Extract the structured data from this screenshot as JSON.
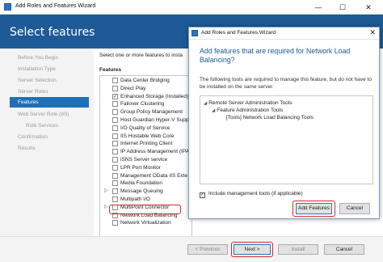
{
  "window": {
    "title": "Add Roles and Features Wizard",
    "minimize_glyph": "—",
    "maximize_glyph": "☐",
    "close_glyph": "✕"
  },
  "header": {
    "page_title": "Select features"
  },
  "nav": {
    "items": [
      {
        "label": "Before You Begin"
      },
      {
        "label": "Installation Type"
      },
      {
        "label": "Server Selection"
      },
      {
        "label": "Server Roles"
      },
      {
        "label": "Features"
      },
      {
        "label": "Web Server Role (IIS)"
      },
      {
        "label": "Role Services"
      },
      {
        "label": "Confirmation"
      },
      {
        "label": "Results"
      }
    ]
  },
  "main": {
    "intro": "Select one or more features to insta",
    "features_label": "Features",
    "features": [
      {
        "label": "Data Center Bridging",
        "checked": false,
        "expander": ""
      },
      {
        "label": "Direct Play",
        "checked": false,
        "expander": ""
      },
      {
        "label": "Enhanced Storage (Installed)",
        "checked": true,
        "expander": ""
      },
      {
        "label": "Failover Clustering",
        "checked": false,
        "expander": ""
      },
      {
        "label": "Group Policy Management",
        "checked": false,
        "expander": ""
      },
      {
        "label": "Host Guardian Hyper-V Support",
        "checked": false,
        "expander": ""
      },
      {
        "label": "I/O Quality of Service",
        "checked": false,
        "expander": ""
      },
      {
        "label": "IIS Hostable Web Core",
        "checked": false,
        "expander": ""
      },
      {
        "label": "Internet Printing Client",
        "checked": false,
        "expander": ""
      },
      {
        "label": "IP Address Management (IPAM)",
        "checked": false,
        "expander": ""
      },
      {
        "label": "iSNS Server service",
        "checked": false,
        "expander": ""
      },
      {
        "label": "LPR Port Monitor",
        "checked": false,
        "expander": ""
      },
      {
        "label": "Management OData IIS Exte",
        "checked": false,
        "expander": ""
      },
      {
        "label": "Media Foundation",
        "checked": false,
        "expander": ""
      },
      {
        "label": "Message Queuing",
        "checked": false,
        "expander": "▷"
      },
      {
        "label": "Multipath I/O",
        "checked": false,
        "expander": ""
      },
      {
        "label": "MultiPoint Connector",
        "checked": false,
        "expander": "▷"
      },
      {
        "label": "Network Load Balancing",
        "checked": false,
        "expander": ""
      },
      {
        "label": "Network Virtualization",
        "checked": false,
        "expander": ""
      }
    ]
  },
  "footer": {
    "previous_label": "< Previous",
    "next_label": "Next >",
    "install_label": "Install",
    "cancel_label": "Cancel"
  },
  "dialog": {
    "title": "Add Roles and Features Wizard",
    "close_glyph": "✕",
    "heading": "Add features that are required for Network Load Balancing?",
    "description": "The following tools are required to manage this feature, but do not have to be installed on the same server.",
    "tree": [
      {
        "label": "Remote Server Administration Tools",
        "arrow": "◢"
      },
      {
        "label": "Feature Administration Tools",
        "arrow": "◢"
      },
      {
        "label": "[Tools] Network Load Balancing Tools",
        "arrow": ""
      }
    ],
    "include_tools_label": "Include management tools (if applicable)",
    "include_tools_checked_glyph": "✓",
    "add_features_label": "Add Features",
    "cancel_label": "Cancel"
  },
  "colors": {
    "header_blue": "#1d5a96",
    "nav_active": "#1d6fb8",
    "highlight_red": "#d9262c",
    "dialog_heading": "#1d5a96"
  }
}
